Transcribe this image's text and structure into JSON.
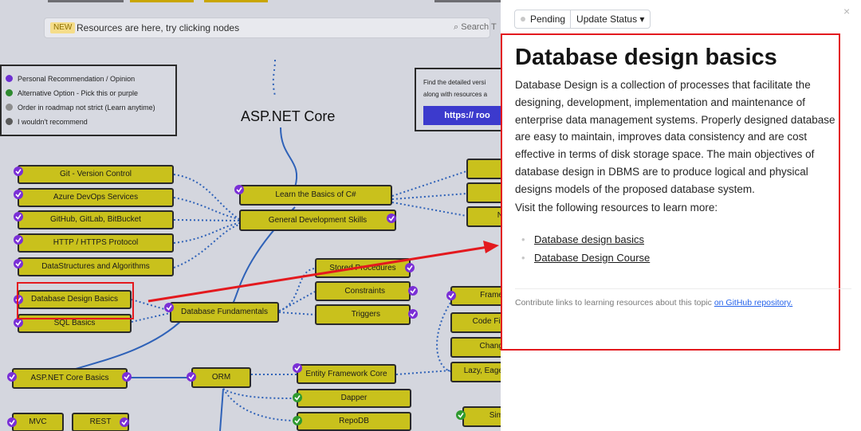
{
  "banner": {
    "tag": "NEW",
    "message": "Resources are here, try clicking nodes",
    "search_placeholder": "Search T"
  },
  "legend": {
    "items": [
      {
        "label": "Personal Recommendation / Opinion",
        "color": "#6d2fd0"
      },
      {
        "label": "Alternative Option - Pick this or purple",
        "color": "#2f8a2f"
      },
      {
        "label": "Order in roadmap not strict (Learn anytime)",
        "color": "#8d8d8d"
      },
      {
        "label": "I wouldn't recommend",
        "color": "#5a5a5a"
      }
    ]
  },
  "infobox": {
    "line1": "Find the detailed versi",
    "line2": "along with resources a",
    "link": "https:// roo"
  },
  "roadmap": {
    "title": "ASP.NET Core",
    "nodes": {
      "git": "Git - Version Control",
      "azure": "Azure DevOps Services",
      "github": "GitHub, GitLab, BitBucket",
      "http": "HTTP / HTTPS Protocol",
      "ds": "DataStructures and Algorithms",
      "dbdesign": "Database Design Basics",
      "sql": "SQL Basics",
      "csharp": "Learn the Basics of C#",
      "general": "General Development Skills",
      "dbfund": "Database Fundamentals",
      "stored": "Stored Procedures",
      "constraints": "Constraints",
      "triggers": "Triggers",
      "aspbasics": "ASP.NET Core Basics",
      "orm": "ORM",
      "efcore": "Entity Framework Core",
      "dapper": "Dapper",
      "repodb": "RepoDB",
      "mvc": "MVC",
      "rest": "REST",
      "frame": "Frame",
      "codefirst": "Code Fir",
      "change": "Chang",
      "lazy": "Lazy, Eage",
      "sim": "Sim",
      "n": "N"
    }
  },
  "panel": {
    "status": "Pending",
    "update_status": "Update Status ▾",
    "close": "×",
    "title": "Database design basics",
    "description": "Database Design is a collection of processes that facilitate the designing, development, implementation and maintenance of enterprise data management systems. Properly designed database are easy to maintain, improves data consistency and are cost effective in terms of disk storage space. The main objectives of database design in DBMS are to produce logical and physical designs models of the proposed database system.",
    "visit": "Visit the following resources to learn more:",
    "links": [
      "Database design basics",
      "Database Design Course"
    ],
    "contribute_text": "Contribute links to learning resources about this topic ",
    "contribute_link": "on GitHub repository."
  },
  "colors": {
    "node": "#c9c11c",
    "purple_check": "#7a2fd6",
    "green_check": "#2f9a2f",
    "highlight": "#e3191e",
    "link_blue": "#2563eb"
  }
}
